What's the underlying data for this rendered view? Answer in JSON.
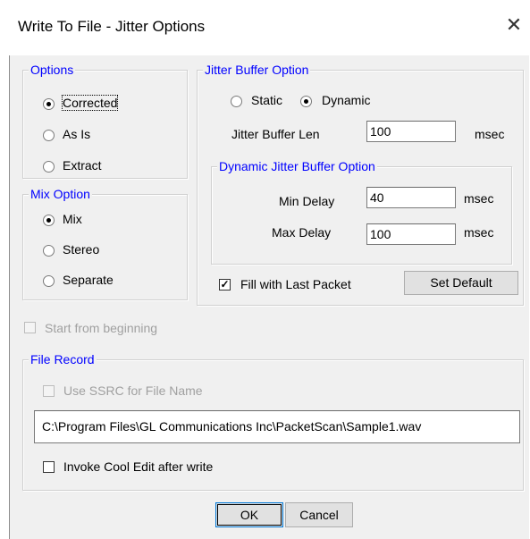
{
  "window": {
    "title": "Write To File - Jitter Options",
    "close_glyph": "✕"
  },
  "options": {
    "legend": "Options",
    "items": [
      {
        "label": "Corrected",
        "selected": true
      },
      {
        "label": "As Is",
        "selected": false
      },
      {
        "label": "Extract",
        "selected": false
      }
    ]
  },
  "mix_option": {
    "legend": "Mix Option",
    "items": [
      {
        "label": "Mix",
        "selected": true
      },
      {
        "label": "Stereo",
        "selected": false
      },
      {
        "label": "Separate",
        "selected": false
      }
    ]
  },
  "jitter_buffer": {
    "legend": "Jitter Buffer Option",
    "static_label": "Static",
    "dynamic_label": "Dynamic",
    "selected": "Dynamic",
    "len_label": "Jitter Buffer Len",
    "len_value": "100",
    "len_unit": "msec",
    "dynamic": {
      "legend": "Dynamic Jitter Buffer Option",
      "min_label": "Min Delay",
      "min_value": "40",
      "min_unit": "msec",
      "max_label": "Max Delay",
      "max_value": "100",
      "max_unit": "msec"
    },
    "fill_label": "Fill with Last Packet",
    "fill_checked": true,
    "set_default_label": "Set Default"
  },
  "start_from_beginning": {
    "label": "Start from beginning",
    "checked": false,
    "enabled": false
  },
  "file_record": {
    "legend": "File Record",
    "ssrc_label": "Use SSRC for File Name",
    "ssrc_enabled": false,
    "path": "C:\\Program Files\\GL Communications Inc\\PacketScan\\Sample1.wav",
    "cool_edit_label": "Invoke Cool Edit after write",
    "cool_edit_checked": false
  },
  "buttons": {
    "ok": "OK",
    "cancel": "Cancel"
  },
  "colors": {
    "legend_text": "#0000ff",
    "disabled_text": "#a0a0a0",
    "dialog_bg": "#f0f0f0",
    "default_button_border": "#0078d7"
  }
}
